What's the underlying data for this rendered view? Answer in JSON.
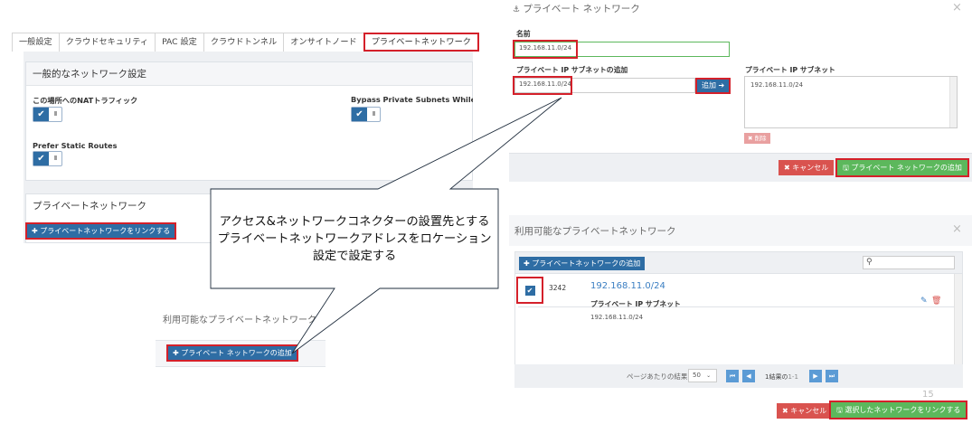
{
  "tabs": [
    "一般設定",
    "クラウドセキュリティ",
    "PAC 設定",
    "クラウドトンネル",
    "オンサイトノード",
    "プライベートネットワーク"
  ],
  "general_section": {
    "title": "一般的なネットワーク設定",
    "nat_label": "この場所へのNATトラフィック",
    "bypass_label": "Bypass Private Subnets While at T",
    "static_routes_label": "Prefer Static Routes",
    "toggle_on_glyph": "✔",
    "toggle_off_glyph": "III"
  },
  "private_section": {
    "title": "プライベートネットワーク",
    "link_button": "✚ プライベートネットワークをリンクする"
  },
  "left_available": {
    "title": "利用可能なプライベートネットワーク",
    "add_button": "✚ プライベート ネットワークの追加"
  },
  "add_modal": {
    "title": "プライベート ネットワーク",
    "title_icon": "⚓",
    "close": "×",
    "name_label": "名前",
    "name_value": "192.168.11.0/24",
    "subnet_add_label": "プライベート IP サブネットの追加",
    "subnet_input_value": "192.168.11.0/24",
    "add_button": "追加 ➔",
    "subnet_list_label": "プライベート IP サブネット",
    "subnet_list_value": "192.168.11.0/24",
    "delete_button": "✖ 削除",
    "cancel_button": "✖ キャンセル",
    "submit_button": "🖫 プライベート ネットワークの追加"
  },
  "available_modal": {
    "title": "利用可能なプライベートネットワーク",
    "close": "×",
    "add_button": "✚ プライベートネットワークの追加",
    "search_icon": "⚲",
    "row": {
      "id": "3242",
      "name": "192.168.11.0/24",
      "subnet_label": "プライベート IP サブネット",
      "subnet_value": "192.168.11.0/24"
    },
    "pager": {
      "per_page_label": "ページあたりの結果:",
      "per_page_value": "50",
      "results_text": "1結果の",
      "results_range": "1-1",
      "first": "⏮",
      "prev": "◀",
      "next": "▶",
      "last": "⏭"
    },
    "cancel_button": "✖ キャンセル",
    "link_button": "🖫 選択したネットワークをリンクする"
  },
  "callout": {
    "line1": "アクセス&ネットワークコネクターの設置先とする",
    "line2": "プライベートネットワークアドレスをロケーション",
    "line3": "設定で設定する"
  },
  "page_number": "15",
  "colors": {
    "highlight": "#d4202a",
    "primary_blue": "#2e6da4",
    "danger": "#d9534f",
    "success": "#5cb85c"
  }
}
